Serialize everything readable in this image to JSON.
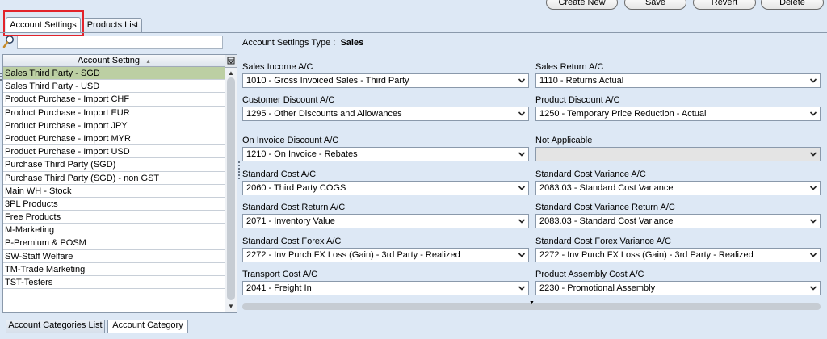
{
  "toolbar": {
    "create_new": "Create New",
    "save": "Save",
    "revert": "Revert",
    "delete": "Delete"
  },
  "tabs": [
    {
      "label": "Account Settings",
      "active": true
    },
    {
      "label": "Products List",
      "active": false
    }
  ],
  "search": {
    "icon": "search-icon",
    "value": ""
  },
  "list": {
    "header": "Account Setting",
    "sort_icon": "▲",
    "column_menu_icon": "column-chooser-icon",
    "items": [
      "Sales Third Party - SGD",
      "Sales Third Party - USD",
      "Product Purchase - Import CHF",
      "Product Purchase - Import EUR",
      "Product Purchase - Import JPY",
      "Product Purchase - Import MYR",
      "Product Purchase - Import USD",
      "Purchase Third Party (SGD)",
      "Purchase Third Party (SGD) - non GST",
      "Main WH - Stock",
      "3PL Products",
      "Free Products",
      "M-Marketing",
      "P-Premium & POSM",
      "SW-Staff Welfare",
      "TM-Trade Marketing",
      "TST-Testers"
    ],
    "selected_index": 0
  },
  "form": {
    "type_label": "Account Settings Type :",
    "type_value": "Sales",
    "fields": [
      {
        "label": "Sales Income A/C",
        "value": "1010 - Gross Invoiced Sales - Third Party"
      },
      {
        "label": "Sales Return A/C",
        "value": "1110 - Returns Actual"
      },
      {
        "label": "Customer Discount A/C",
        "value": "1295 - Other Discounts and Allowances"
      },
      {
        "label": "Product Discount A/C",
        "value": "1250 - Temporary Price Reduction - Actual"
      },
      {
        "label": "On Invoice Discount A/C",
        "value": "1210 - On Invoice - Rebates"
      },
      {
        "label": "Not Applicable",
        "value": ""
      },
      {
        "label": "Standard Cost A/C",
        "value": "2060 - Third Party COGS"
      },
      {
        "label": "Standard Cost Variance A/C",
        "value": "2083.03 - Standard Cost Variance"
      },
      {
        "label": "Standard Cost Return A/C",
        "value": "2071 - Inventory Value"
      },
      {
        "label": "Standard Cost Variance Return A/C",
        "value": "2083.03 - Standard Cost Variance"
      },
      {
        "label": "Standard Cost Forex A/C",
        "value": "2272 - Inv Purch FX Loss (Gain) - 3rd Party - Realized"
      },
      {
        "label": "Standard Cost Forex Variance A/C",
        "value": "2272 - Inv Purch FX Loss (Gain) - 3rd Party - Realized"
      },
      {
        "label": "Transport Cost A/C",
        "value": "2041 - Freight In"
      },
      {
        "label": "Product Assembly Cost A/C",
        "value": "2230 - Promotional Assembly"
      }
    ]
  },
  "bottom_tabs": [
    {
      "label": "Account Categories List",
      "active": false
    },
    {
      "label": "Account Category",
      "active": true
    }
  ],
  "colors": {
    "background": "#dde8f5",
    "selected_row": "#bccfa3",
    "highlight_box": "#e2232b"
  }
}
